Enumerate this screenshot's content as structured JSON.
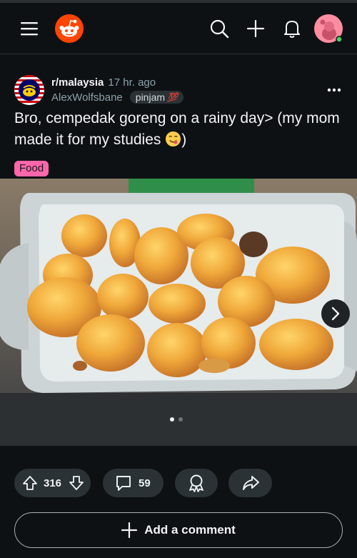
{
  "topbar": {
    "icons": [
      "hamburger-menu-icon",
      "reddit-logo-icon",
      "search-icon",
      "plus-icon",
      "bell-icon",
      "user-avatar-icon"
    ],
    "brand_color": "#ff4500",
    "avatar_color": "#ff8da1",
    "online_color": "#46d160"
  },
  "post": {
    "subreddit": "r/malaysia",
    "time": "17 hr. ago",
    "username": "AlexWolfsbane",
    "flair_text": "pinjam",
    "flair_emoji": "💯",
    "title": "Bro, cempedak goreng on a rainy day> (my mom made it for my studies",
    "title_close": ")",
    "tag": "Food",
    "tag_color": "#ff66ac"
  },
  "media": {
    "image_count": 2,
    "active_index": 0
  },
  "actions": {
    "upvotes": "316",
    "comments": "59",
    "add_comment_label": "Add a comment"
  }
}
